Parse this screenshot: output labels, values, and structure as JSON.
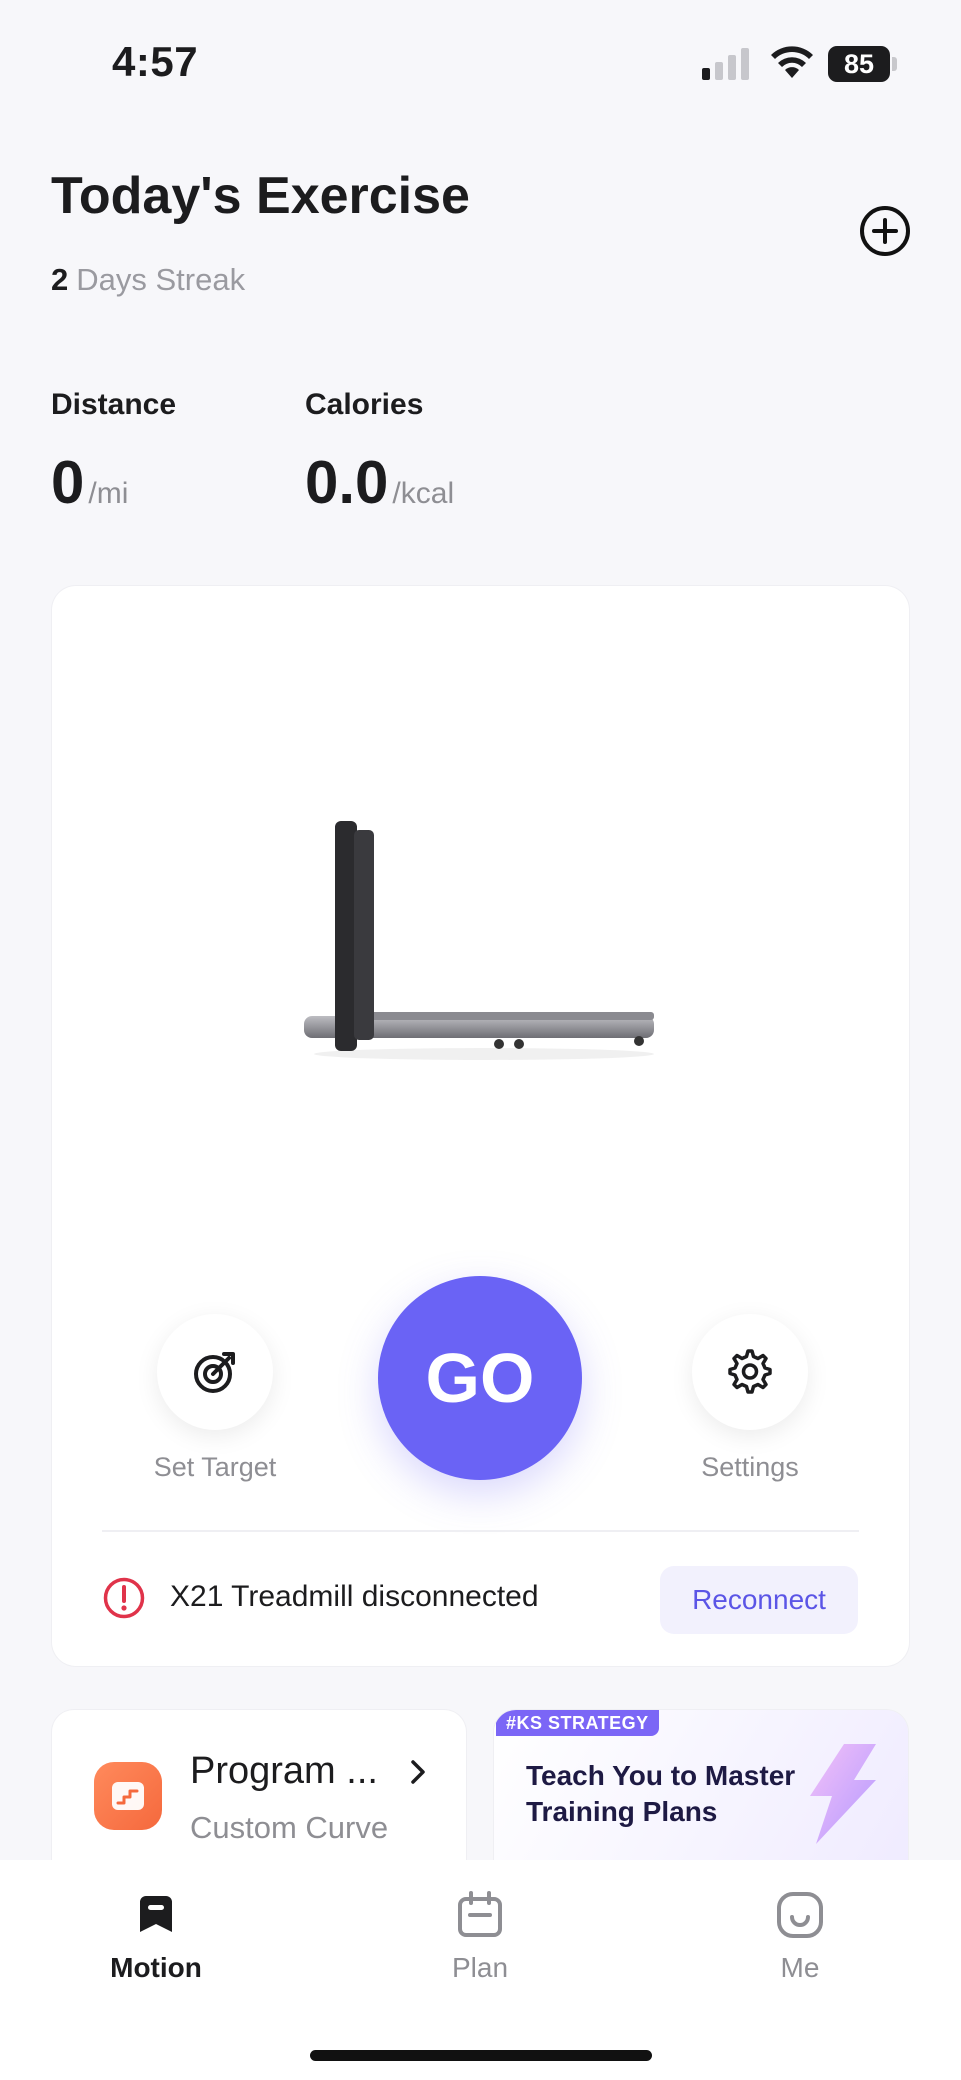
{
  "status_bar": {
    "time": "4:57",
    "battery": "85"
  },
  "header": {
    "title": "Today's Exercise",
    "streak_count": "2",
    "streak_label": "Days Streak"
  },
  "stats": {
    "distance": {
      "label": "Distance",
      "value": "0",
      "unit": "/mi"
    },
    "calories": {
      "label": "Calories",
      "value": "0.0",
      "unit": "/kcal"
    }
  },
  "device_card": {
    "set_target_label": "Set Target",
    "go_label": "GO",
    "settings_label": "Settings",
    "alert_text": "X21 Treadmill disconnected",
    "reconnect_label": "Reconnect"
  },
  "program_card": {
    "title": "Program ...",
    "subtitle": "Custom Curve"
  },
  "strategy_card": {
    "tag": "#KS STRATEGY",
    "title": "Teach You to Master Training Plans"
  },
  "tabs": [
    {
      "label": "Motion",
      "icon": "motion-icon",
      "active": true
    },
    {
      "label": "Plan",
      "icon": "calendar-icon",
      "active": false
    },
    {
      "label": "Me",
      "icon": "face-icon",
      "active": false
    }
  ],
  "colors": {
    "accent": "#6a63f5",
    "alert": "#e0334a",
    "program_icon": "#f5693d",
    "tag": "#7b66f6"
  }
}
